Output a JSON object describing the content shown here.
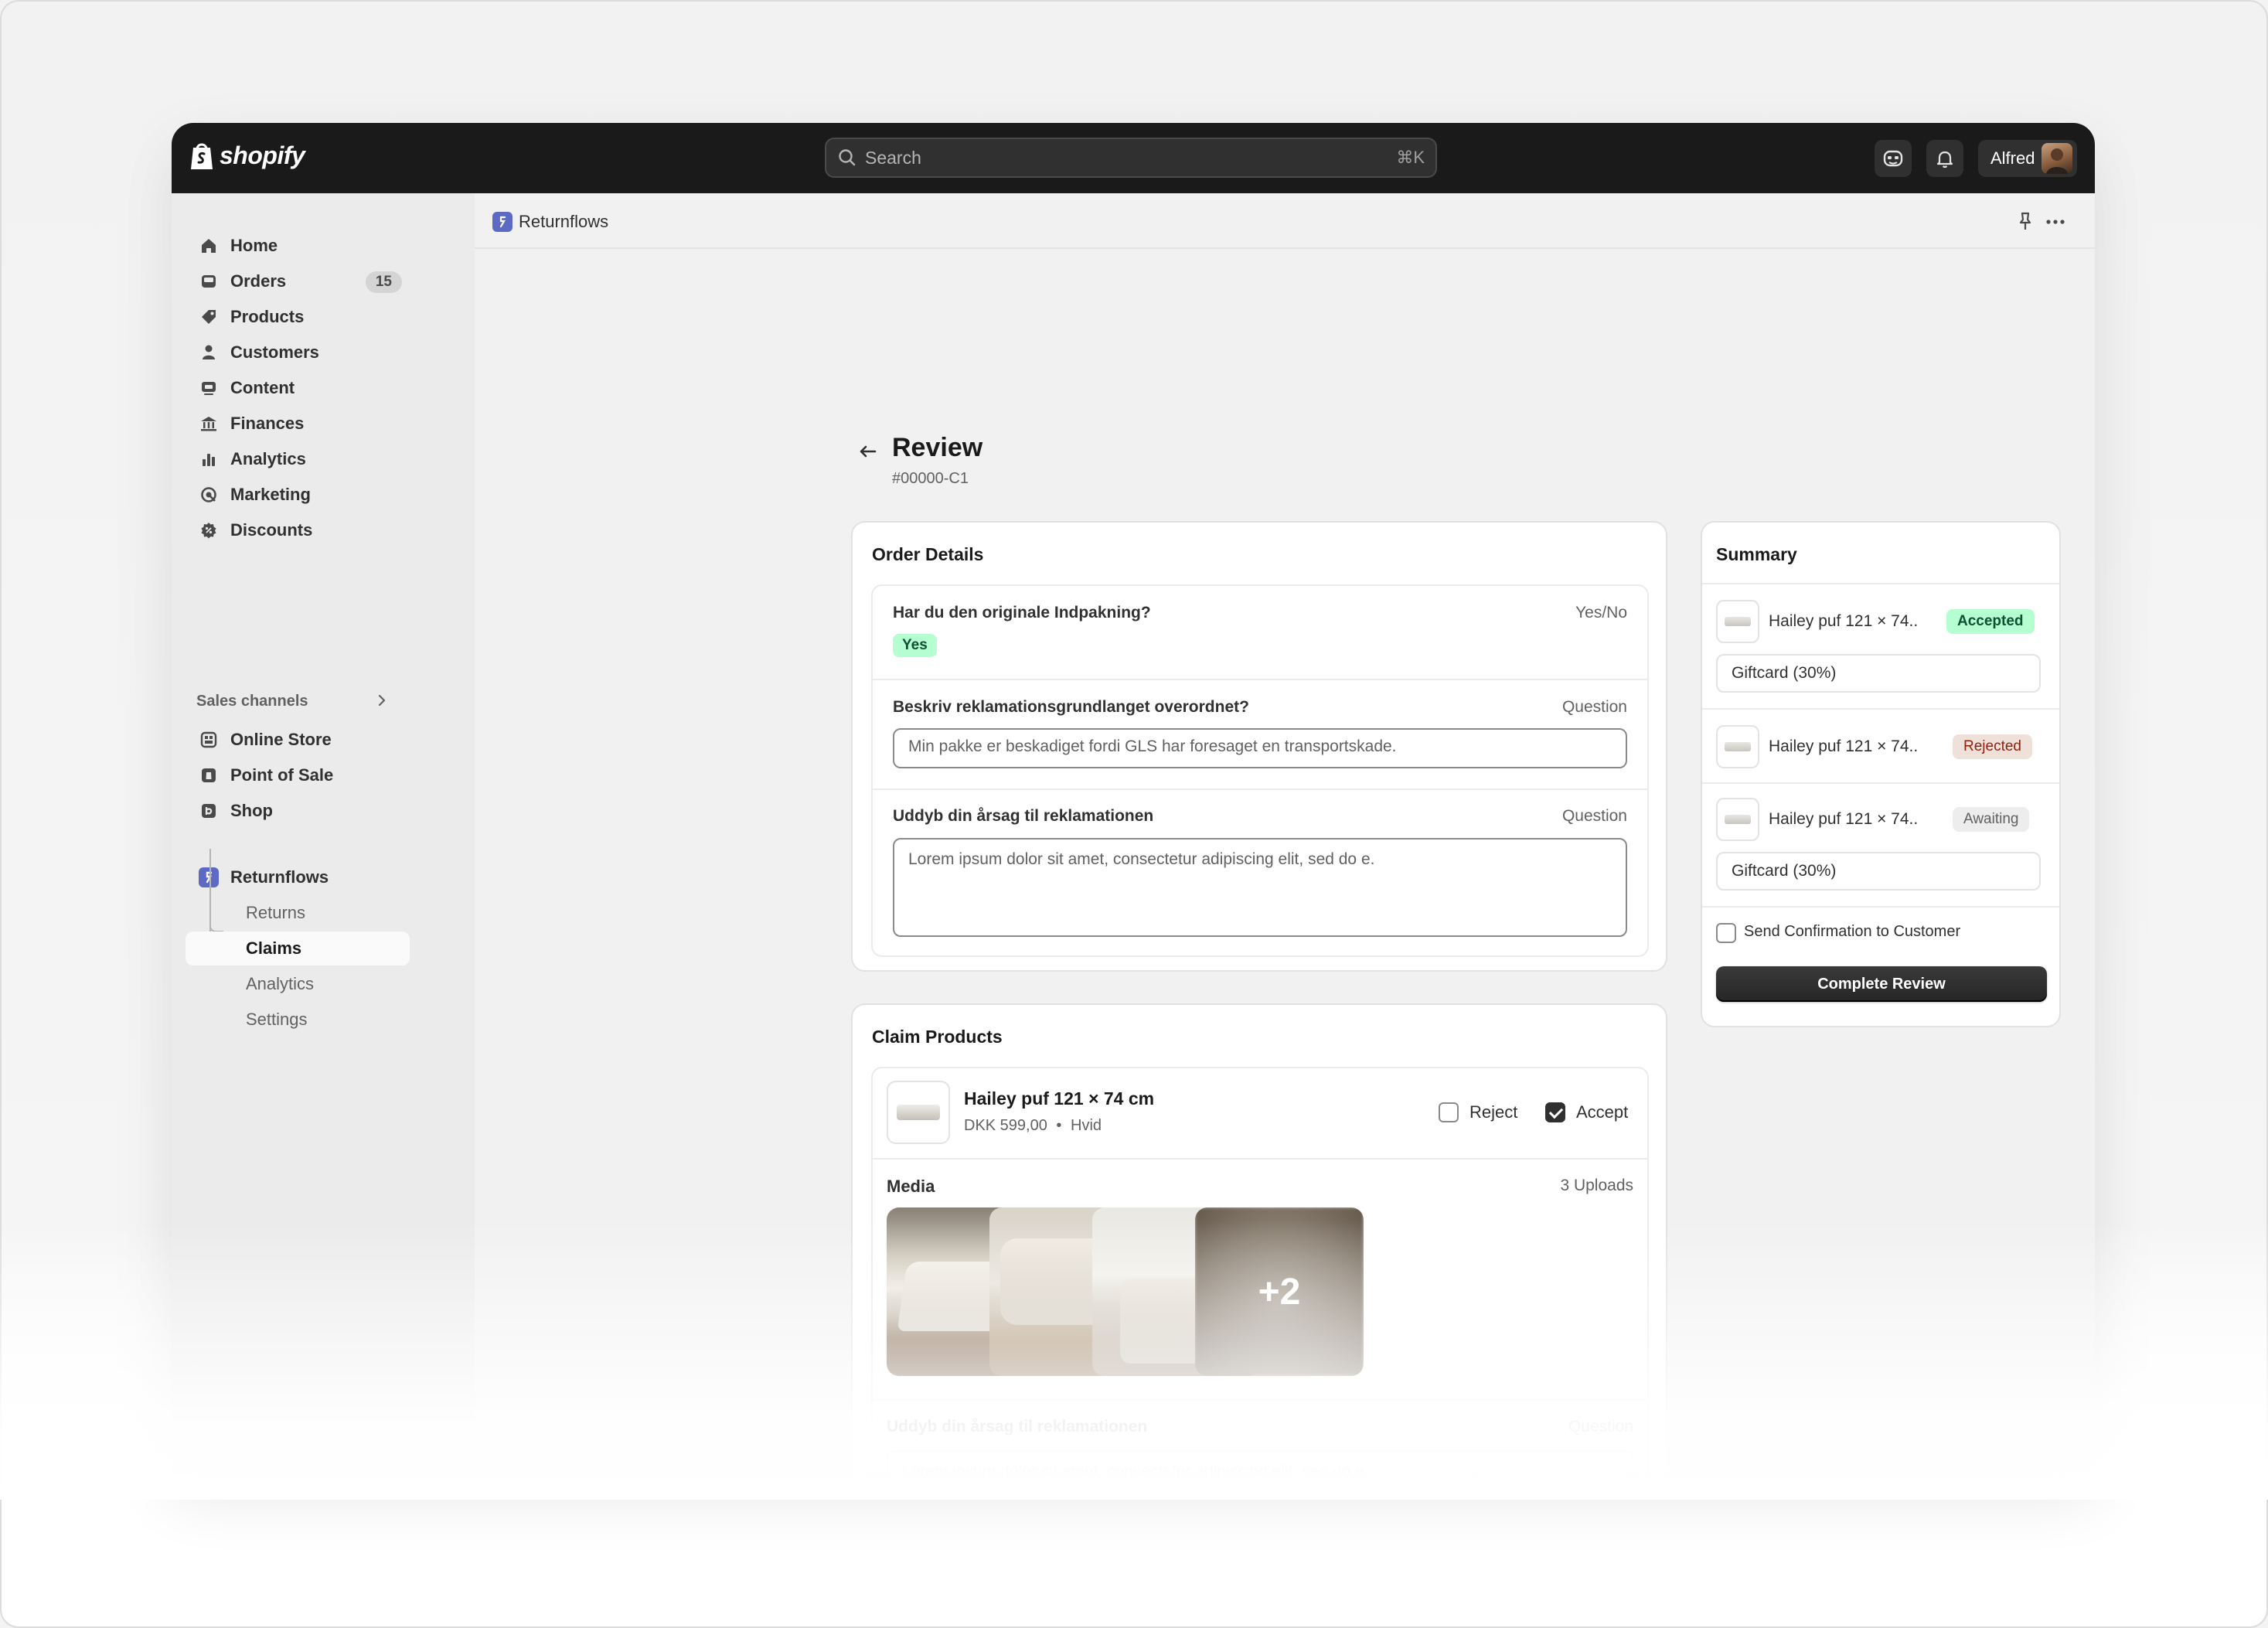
{
  "topbar": {
    "brand": "shopify",
    "search_placeholder": "Search",
    "search_shortcut": "⌘K",
    "user_name": "Alfred"
  },
  "sidebar": {
    "items": [
      {
        "label": "Home",
        "icon": "home-icon"
      },
      {
        "label": "Orders",
        "icon": "inbox-icon",
        "badge": "15"
      },
      {
        "label": "Products",
        "icon": "tag-icon"
      },
      {
        "label": "Customers",
        "icon": "person-icon"
      },
      {
        "label": "Content",
        "icon": "content-icon"
      },
      {
        "label": "Finances",
        "icon": "bank-icon"
      },
      {
        "label": "Analytics",
        "icon": "bar-chart-icon"
      },
      {
        "label": "Marketing",
        "icon": "target-icon"
      },
      {
        "label": "Discounts",
        "icon": "discount-icon"
      }
    ],
    "sales_channels_label": "Sales channels",
    "channels": [
      {
        "label": "Online Store",
        "icon": "store-icon"
      },
      {
        "label": "Point of Sale",
        "icon": "pos-icon"
      },
      {
        "label": "Shop",
        "icon": "shop-icon"
      }
    ],
    "app": {
      "label": "Returnflows",
      "icon": "returnflows-icon"
    },
    "app_subitems": [
      {
        "label": "Returns"
      },
      {
        "label": "Claims",
        "active": true
      },
      {
        "label": "Analytics"
      },
      {
        "label": "Settings"
      }
    ]
  },
  "appbar": {
    "title": "Returnflows"
  },
  "page": {
    "title": "Review",
    "subtitle": "#00000-C1"
  },
  "order_details": {
    "title": "Order Details",
    "questions": [
      {
        "label": "Har du den originale Indpakning?",
        "type": "Yes/No",
        "answer": "Yes"
      },
      {
        "label": "Beskriv reklamationsgrundlanget overordnet?",
        "type": "Question",
        "answer": "Min pakke er beskadiget fordi GLS har foresaget en transportskade."
      },
      {
        "label": "Uddyb din årsag til reklamationen",
        "type": "Question",
        "answer": "Lorem ipsum dolor sit amet, consectetur adipiscing elit, sed do e."
      }
    ]
  },
  "claim_products": {
    "title": "Claim Products",
    "product": {
      "name": "Hailey puf 121 × 74 cm",
      "price": "DKK 599,00",
      "variant": "Hvid",
      "separator": "•",
      "reject_label": "Reject",
      "accept_label": "Accept",
      "reject_checked": false,
      "accept_checked": true
    },
    "media": {
      "label": "Media",
      "count": "3 Uploads",
      "more": "+2"
    },
    "reason": {
      "label": "Uddyb din årsag til reklamationen",
      "type": "Question",
      "text": "Lorem ipsum dolor sit amet, consectetur adipiscing elit, sed do e."
    }
  },
  "summary": {
    "title": "Summary",
    "items": [
      {
        "name": "Hailey puf 121 × 74..",
        "status": "Accepted",
        "gift": "Giftcard (30%)"
      },
      {
        "name": "Hailey puf 121 × 74..",
        "status": "Rejected"
      },
      {
        "name": "Hailey puf 121 × 74..",
        "status": "Awaiting",
        "gift": "Giftcard (30%)"
      }
    ],
    "send_confirmation_label": "Send Confirmation to Customer",
    "send_confirmation_checked": false,
    "complete_button": "Complete Review"
  },
  "colors": {
    "topbar": "#1a1a1a",
    "sidebar": "#ebebeb",
    "accepted": "#b4fed2",
    "rejected": "#efe0da",
    "app_icon": "#5c6ac4"
  }
}
